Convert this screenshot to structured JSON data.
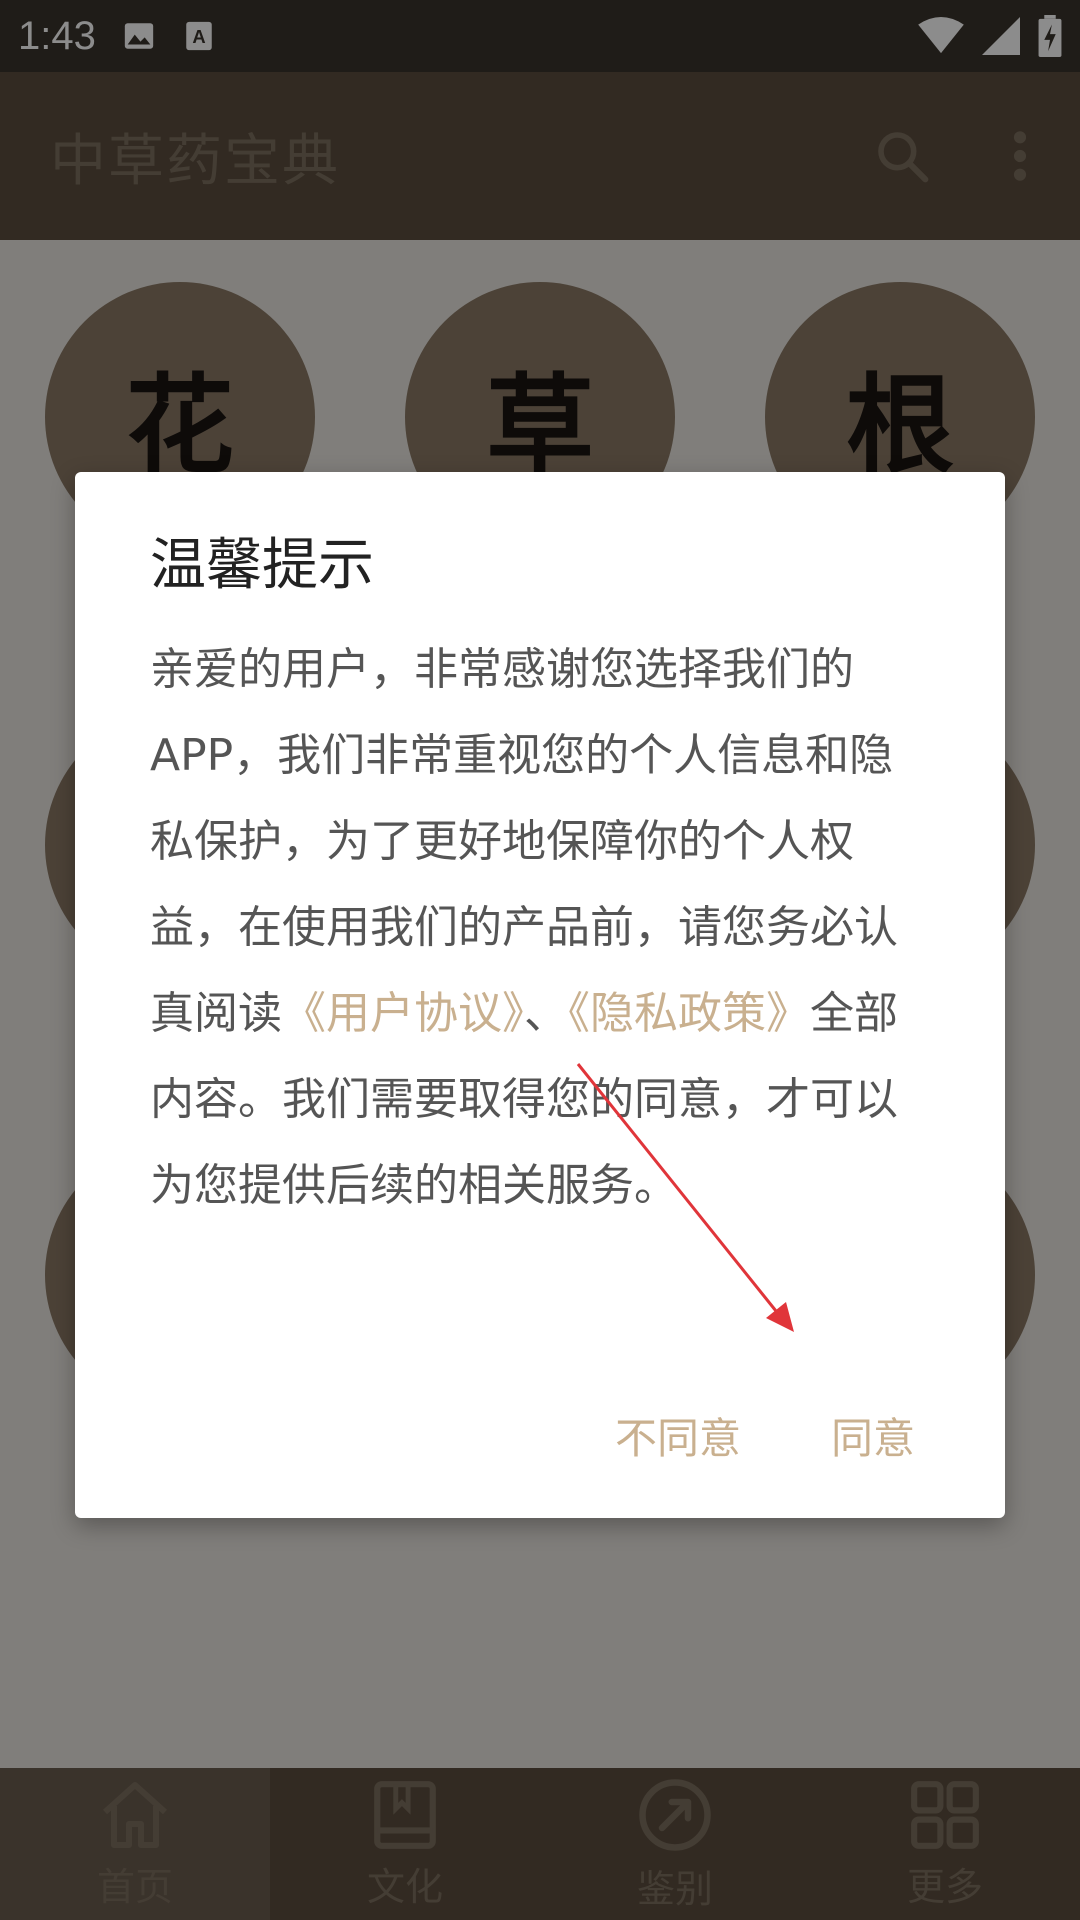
{
  "status_bar": {
    "time": "1:43",
    "icons": [
      "image-icon",
      "text-icon",
      "wifi-icon",
      "signal-icon",
      "battery-icon"
    ]
  },
  "toolbar": {
    "title": "中草药宝典",
    "actions": [
      "search-icon",
      "more-vert-icon"
    ]
  },
  "categories": [
    {
      "label": "花"
    },
    {
      "label": "草"
    },
    {
      "label": "根"
    }
  ],
  "dialog": {
    "title": "温馨提示",
    "body_segments": [
      {
        "text": "亲爱的用户，非常感谢您选择我们的APP，我们非常重视您的个人信息和隐私保护，为了更好地保障你的个人权益，在使用我们的产品前，请您务必认真阅读"
      },
      {
        "text": "《用户协议》",
        "link": true
      },
      {
        "text": "、"
      },
      {
        "text": "《隐私政策》",
        "link": true
      },
      {
        "text": "全部内容。我们需要取得您的同意，才可以为您提供后续的相关服务。"
      }
    ],
    "buttons": {
      "disagree": "不同意",
      "agree": "同意"
    }
  },
  "bottom_nav": {
    "items": [
      {
        "label": "首页",
        "icon": "home-icon"
      },
      {
        "label": "文化",
        "icon": "book-icon"
      },
      {
        "label": "鉴别",
        "icon": "compass-icon"
      },
      {
        "label": "更多",
        "icon": "grid-icon"
      }
    ],
    "active_index": 0
  },
  "colors": {
    "toolbar": "#5b4d3e",
    "accent": "#c9b08f",
    "annotation_arrow": "#e0353a"
  }
}
